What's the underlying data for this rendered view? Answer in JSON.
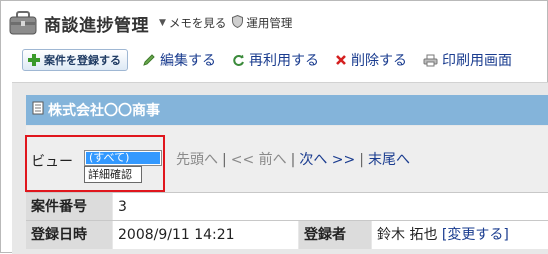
{
  "header": {
    "title": "商談進捗管理",
    "memo_link": "メモを見る",
    "admin_link": "運用管理"
  },
  "toolbar": {
    "register_label": "案件を登録する",
    "edit_label": "編集する",
    "reuse_label": "再利用する",
    "delete_label": "削除する",
    "print_label": "印刷用画面"
  },
  "record": {
    "company": "株式会社〇〇商事"
  },
  "view": {
    "label": "ビュー",
    "selected": "(すべて)",
    "options": [
      "詳細確認"
    ]
  },
  "pager": {
    "first": "先頭へ",
    "prev": "<< 前へ",
    "next": "次へ >>",
    "last": "末尾へ",
    "separator": "|"
  },
  "table": {
    "case_number_label": "案件番号",
    "case_number_value": "3",
    "registered_date_label": "登録日時",
    "registered_date_value": "2008/9/11 14:21",
    "registrant_label": "登録者",
    "registrant_value": "鈴木 拓也",
    "change_link": "[変更する]"
  },
  "colors": {
    "record_bar": "#84b4da",
    "highlight": "#e0161d",
    "link": "#1a3c8f",
    "selected_option": "#3399ff"
  }
}
